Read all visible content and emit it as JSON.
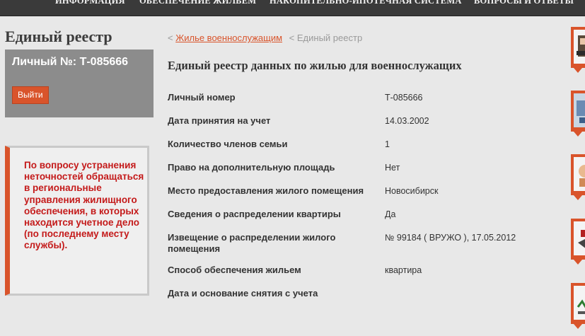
{
  "nav": {
    "items": [
      {
        "label": "Информация"
      },
      {
        "label": "Обеспечение жильем"
      },
      {
        "label": "Накопительно-ипотечная система"
      },
      {
        "label": "Вопросы и ответы"
      }
    ]
  },
  "sidebar": {
    "title": "Единый реестр",
    "personal_number_text": "Личный №: Т-085666",
    "logout_label": "Выйти",
    "notice": "По вопросу устранения неточностей обращаться в региональные управления жилищного обеспечения, в которых находится учетное дело (по последнему месту службы)."
  },
  "breadcrumb": {
    "separator": "<",
    "link": "Жилье военнослужащим",
    "current": "Единый реестр"
  },
  "main": {
    "title": "Единый реестр данных по жилью для военнослужащих",
    "rows": [
      {
        "label": "Личный номер",
        "value": "Т-085666"
      },
      {
        "label": "Дата принятия на учет",
        "value": "14.03.2002"
      },
      {
        "label": "Количество членов семьи",
        "value": "1"
      },
      {
        "label": "Право на дополнительную площадь",
        "value": "Нет"
      },
      {
        "label": "Место предоставления жилого помещения",
        "value": "Новосибирск"
      },
      {
        "label": "Сведения о распределении квартиры",
        "value": "Да"
      },
      {
        "label": "Извещение о распределении жилого помещения",
        "value": "№ 99184 ( ВРУЖО ), 17.05.2012"
      },
      {
        "label": "Способ обеспечения жильем",
        "value": "квартира"
      },
      {
        "label": "Дата и основание снятия с учета",
        "value": ""
      }
    ]
  },
  "colors": {
    "accent": "#d9542b",
    "notice_text": "#c41a1a",
    "nav_bg": "#3a3a3a",
    "user_box_bg": "#8c8c8c"
  }
}
